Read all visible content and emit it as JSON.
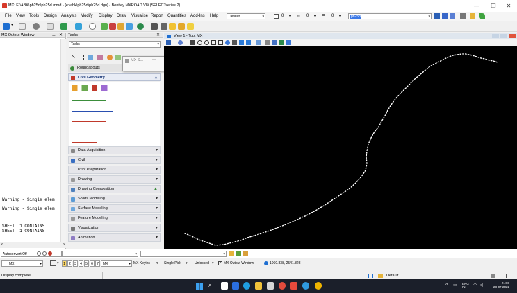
{
  "titlebar": {
    "title": "MX: E:\\ABK\\ph25d\\ph25d.mmd - [e:\\abk\\ph25d\\ph25d.dgn] - Bentley MXROAD V8i (SELECTseries 2)",
    "minimize": "—",
    "maximize": "❐",
    "close": "✕"
  },
  "menu": {
    "items": [
      "File",
      "View",
      "Tools",
      "Design",
      "Analysis",
      "Modify",
      "Display",
      "Draw",
      "Visualise",
      "Report",
      "Quantities",
      "Add-Ins",
      "Help"
    ],
    "level_combo": "Default",
    "color_value": "0",
    "style_value": "0",
    "weight_value": "0",
    "active_field": "ph25d"
  },
  "output_window": {
    "title": "MX Output Window",
    "lines": [
      "Warning - Single elem",
      "Warning - Single elem",
      "",
      "SHEET  1 CONTAINS",
      "SHEET  1 CONTAINS"
    ]
  },
  "tasks": {
    "title": "Tasks",
    "combo": "Tasks",
    "floating_title": "MX S...",
    "roundabouts": "Roundabouts",
    "civil_geometry": "Civil Geometry",
    "bars": [
      "Data Acquisition",
      "Civil",
      "Print Preparation",
      "Drawing",
      "Drawing Composition",
      "Solids Modeling",
      "Surface Modeling",
      "Feature Modeling",
      "Visualization",
      "Animation"
    ]
  },
  "view": {
    "title": "View 1 - Top, MX"
  },
  "command": {
    "autoconvert": "Autoconvert Off"
  },
  "status_toolbar": {
    "mx": "MX",
    "view_nums": [
      "1",
      "2",
      "3",
      "4",
      "5",
      "6",
      "7",
      "8"
    ],
    "mx_combo": "MX",
    "mx_keyins": "MX Keyins",
    "single_pick": "Single Pick",
    "unlocked": "Unlocked",
    "output_window_label": "MX Output Window",
    "coords": "1060.838, 2541.828"
  },
  "statusbar": {
    "message": "Display complete",
    "level": "Default"
  },
  "taskbar": {
    "lang": "ENG",
    "lang2": "IN",
    "time": "21:08",
    "date": "28-07-2022"
  },
  "colors": {
    "accent": "#1f6fd1",
    "canvas": "#000000",
    "route": "#ffffff"
  }
}
